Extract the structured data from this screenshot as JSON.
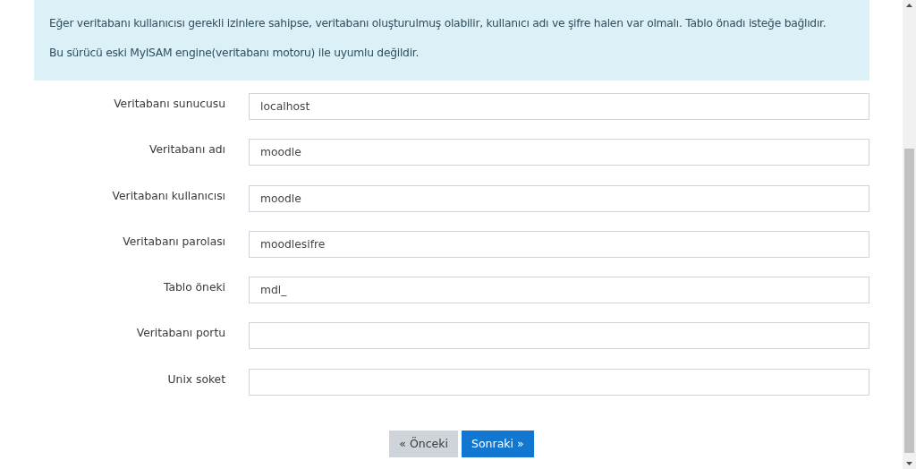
{
  "notice": {
    "paragraphs": [
      "Eğer veritabanı kullanıcısı gerekli izinlere sahipse, veritabanı oluşturulmuş olabilir, kullanıcı adı ve şifre halen var olmalı. Tablo önadı isteğe bağlıdır.",
      "Bu sürücü eski MyISAM engine(veritabanı motoru) ile uyumlu değildir."
    ]
  },
  "fields": [
    {
      "label": "Veritabanı sunucusu",
      "value": "localhost"
    },
    {
      "label": "Veritabanı adı",
      "value": "moodle"
    },
    {
      "label": "Veritabanı kullanıcısı",
      "value": "moodle"
    },
    {
      "label": "Veritabanı parolası",
      "value": "moodlesifre"
    },
    {
      "label": "Tablo öneki",
      "value": "mdl_"
    },
    {
      "label": "Veritabanı portu"
    },
    {
      "label": "Unix soket"
    }
  ],
  "buttons": [
    {
      "label": "« Önceki",
      "kind": "secondary"
    },
    {
      "label": "Sonraki »",
      "kind": "primary"
    }
  ]
}
